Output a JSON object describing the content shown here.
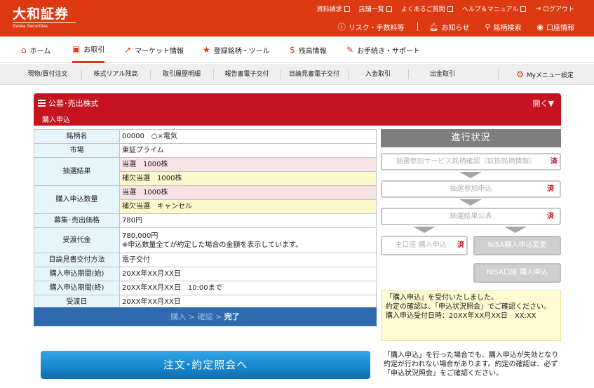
{
  "header": {
    "logo": "大和証券",
    "logo_sub": "Daiwa Securities",
    "top_links": [
      "資料請求",
      "店舗一覧",
      "よくあるご質問",
      "ヘルプ＆マニュアル"
    ],
    "logout": "ログアウト",
    "sub_links": [
      "リスク・手数料等",
      "お知らせ",
      "銘柄検索",
      "口座情報"
    ]
  },
  "nav": [
    "ホーム",
    "お取引",
    "マーケット情報",
    "登録銘柄・ツール",
    "残高情報",
    "お手続き・サポート"
  ],
  "subnav": [
    "現物/買付注文",
    "株式リアル残高",
    "取引履歴明細",
    "報告書電子交付",
    "目論見書電子交付",
    "入金取引",
    "出金取引",
    "Myメニュー設定"
  ],
  "panel": {
    "title": "公募･売出株式",
    "open": "開く▼",
    "subtitle": "購入申込"
  },
  "table": [
    {
      "label": "銘柄名",
      "value": "00000　○×電気"
    },
    {
      "label": "市場",
      "value": "東証プライム"
    },
    {
      "label": "抽選結果",
      "value": "当選　1000株",
      "value2": "補欠当選　1000株"
    },
    {
      "label": "購入申込数量",
      "value": "当選　1000株",
      "value2": "補欠当選　キャンセル"
    },
    {
      "label": "募集･売出価格",
      "value": "780円"
    },
    {
      "label": "受渡代金",
      "value": "780,000円",
      "value2": "※申込数量全てが約定した場合の金額を表示しています。"
    },
    {
      "label": "目論見書交付方法",
      "value": "電子交付"
    },
    {
      "label": "購入申込期間(始)",
      "value": "20XX年XX月XX日"
    },
    {
      "label": "購入申込期間(終)",
      "value": "20XX年XX月XX日　10:00まで"
    },
    {
      "label": "受渡日",
      "value": "20XX年XX月XX日"
    }
  ],
  "steps": {
    "s1": "購入",
    "sep": " > ",
    "s2": "確認",
    "s3": "完了"
  },
  "progress": {
    "title": "進行状況",
    "done": "済",
    "items": [
      "抽選参加サービス銘柄確認（取扱銘柄情報）",
      "抽選参加申込",
      "抽選結果公表",
      "主口座 購入申込",
      "NISA購入申込変更",
      "NISA口座 購入申込"
    ]
  },
  "notice": {
    "l1": "「購入申込」を受付いたしました。",
    "l2": "約定の確認は、「申込状況照会」でご確認ください。",
    "l3": "購入申込受付日時：20XX年XX月XX日　XX:XX"
  },
  "button": "注文･約定照会へ",
  "caution": "「購入申込」を行った場合でも、購入申込が失効となり約定が行われない場合があります。約定の確認は、必ず「申込状況照会」をご確認ください。"
}
